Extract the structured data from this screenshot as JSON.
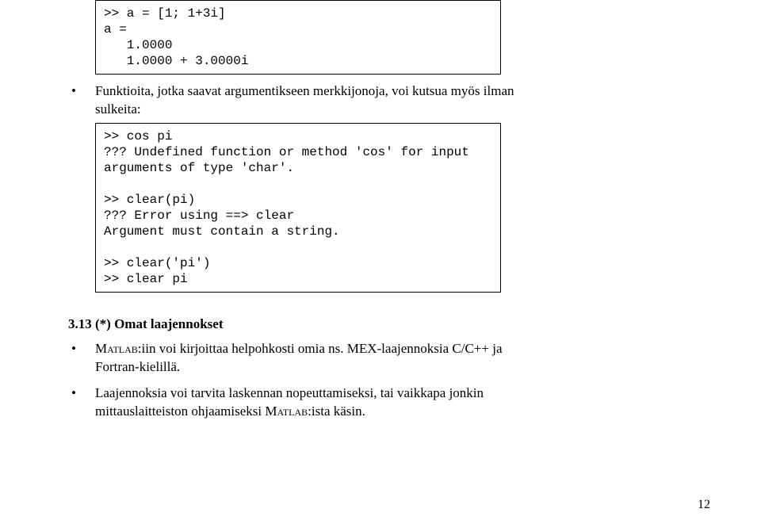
{
  "code_block_1": ">> a = [1; 1+3i]\na =\n   1.0000\n   1.0000 + 3.0000i",
  "bullet_funcs": "Funktioita, jotka saavat argumentikseen merkkijonoja, voi kutsua myös ilman sulkeita:",
  "code_block_2": ">> cos pi\n??? Undefined function or method 'cos' for input\narguments of type 'char'.\n\n>> clear(pi)\n??? Error using ==> clear\nArgument must contain a string.\n\n>> clear('pi')\n>> clear pi",
  "section_title": "3.13 (*) Omat laajennokset",
  "bullet_ext_1_pre": "",
  "bullet_ext_1_matlab": "Matlab",
  "bullet_ext_1_mid": ":iin voi kirjoittaa helpohkosti omia ns. MEX-laajennoksia C/C++ ja Fortran-kielillä.",
  "bullet_ext_2_pre": "Laajennoksia voi tarvita laskennan nopeuttamiseksi, tai vaikkapa jonkin mittauslaitteiston ohjaamiseksi ",
  "bullet_ext_2_matlab": "Matlab",
  "bullet_ext_2_post": ":ista käsin.",
  "page_number": "12"
}
